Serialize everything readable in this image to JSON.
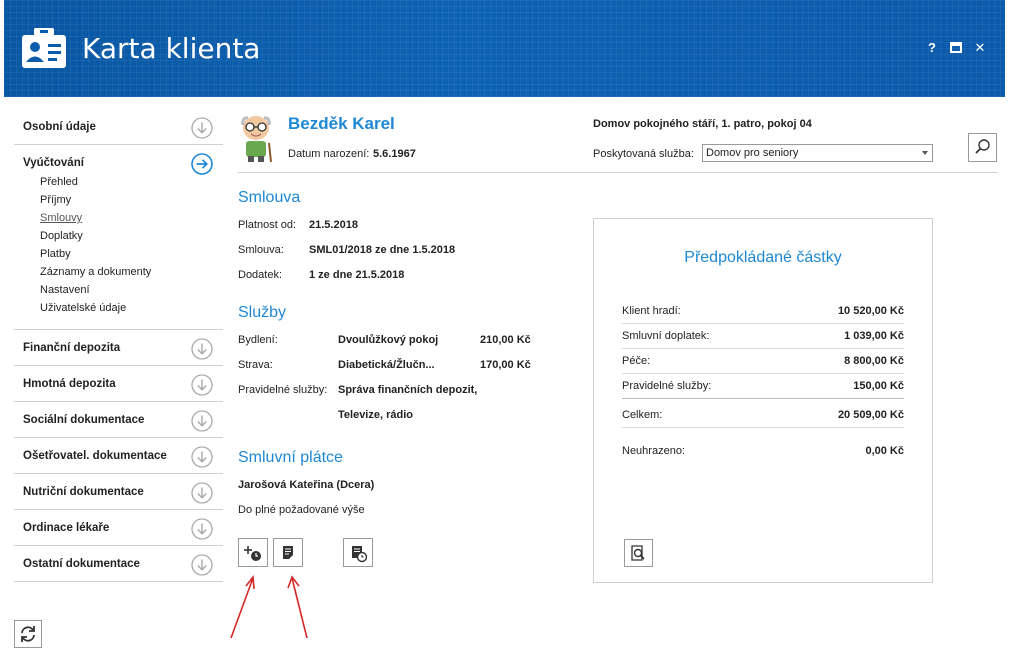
{
  "header": {
    "title": "Karta klienta",
    "help": "?",
    "maximize": "▣",
    "close": "✕",
    "accent": "#0b5dab"
  },
  "sidebar": {
    "sections": [
      {
        "label": "Osobní údaje",
        "icon": "arrow-down-circle-icon"
      },
      {
        "label": "Vyúčtování",
        "icon": "arrow-right-circle-icon",
        "expanded": true,
        "items": [
          "Přehled",
          "Příjmy",
          "Smlouvy",
          "Doplatky",
          "Platby",
          "Záznamy a dokumenty",
          "Nastavení",
          "Uživatelské údaje"
        ],
        "active_item": "Smlouvy"
      },
      {
        "label": "Finanční depozita",
        "icon": "arrow-down-circle-icon"
      },
      {
        "label": "Hmotná depozita",
        "icon": "arrow-down-circle-icon"
      },
      {
        "label": "Sociální dokumentace",
        "icon": "arrow-down-circle-icon"
      },
      {
        "label": "Ošetřovatel. dokumentace",
        "icon": "arrow-down-circle-icon"
      },
      {
        "label": "Nutriční dokumentace",
        "icon": "arrow-down-circle-icon"
      },
      {
        "label": "Ordinace lékaře",
        "icon": "arrow-down-circle-icon"
      },
      {
        "label": "Ostatní dokumentace",
        "icon": "arrow-down-circle-icon"
      }
    ]
  },
  "client": {
    "name": "Bezděk Karel",
    "birth_label": "Datum narození:",
    "birth_date": "5.6.1967",
    "facility": "Domov pokojného stáří, 1. patro, pokoj 04",
    "service_label": "Poskytovaná služba:",
    "service_value": "Domov pro seniory"
  },
  "contract": {
    "title": "Smlouva",
    "valid_from_label": "Platnost od:",
    "valid_from": "21.5.2018",
    "contract_label": "Smlouva:",
    "contract_value": "SML01/2018 ze dne 1.5.2018",
    "addendum_label": "Dodatek:",
    "addendum_value": "1 ze dne 21.5.2018"
  },
  "services": {
    "title": "Služby",
    "housing_label": "Bydlení:",
    "housing_value": "Dvoulůžkový pokoj",
    "housing_price": "210,00 Kč",
    "food_label": "Strava:",
    "food_value": "Diabetická/Žlučn...",
    "food_price": "170,00 Kč",
    "regular_label": "Pravidelné služby:",
    "regular_value_1": "Správa finančních depozit,",
    "regular_value_2": "Televize, rádio"
  },
  "payer": {
    "title": "Smluvní plátce",
    "name": "Jarošová Kateřina (Dcera)",
    "note": "Do plné požadované výše"
  },
  "estimate": {
    "title": "Předpokládané částky",
    "rows": [
      {
        "label": "Klient hradí:",
        "value": "10 520,00 Kč"
      },
      {
        "label": "Smluvní doplatek:",
        "value": "1 039,00 Kč"
      },
      {
        "label": "Péče:",
        "value": "8 800,00 Kč"
      },
      {
        "label": "Pravidelné služby:",
        "value": "150,00 Kč"
      },
      {
        "label": "Celkem:",
        "value": "20 509,00 Kč"
      },
      {
        "label": "Neuhrazeno:",
        "value": "0,00 Kč"
      }
    ]
  },
  "colors": {
    "link_blue": "#1e88d4",
    "arrow_red": "#d42a2a"
  }
}
